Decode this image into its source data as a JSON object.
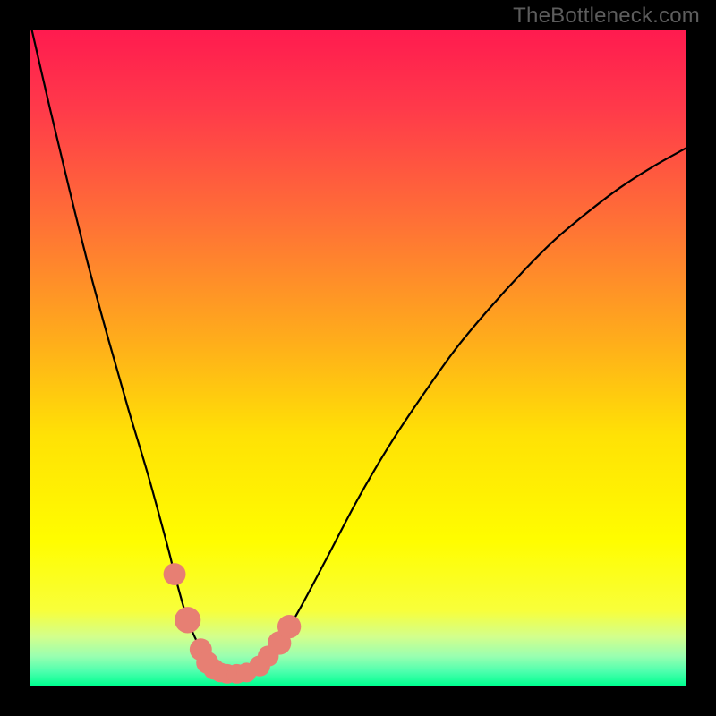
{
  "watermark": "TheBottleneck.com",
  "chart_data": {
    "type": "line",
    "title": "",
    "xlabel": "",
    "ylabel": "",
    "xlim": [
      0,
      100
    ],
    "ylim": [
      0,
      100
    ],
    "series": [
      {
        "name": "curve",
        "x": [
          0.0,
          3.0,
          6.0,
          9.0,
          12.0,
          15.0,
          18.0,
          21.0,
          22.0,
          24.0,
          26.0,
          27.0,
          28.0,
          29.0,
          30.0,
          31.5,
          33.0,
          35.0,
          38.0,
          41.0,
          45.0,
          50.0,
          55.0,
          60.0,
          65.0,
          70.0,
          75.0,
          80.0,
          85.0,
          90.0,
          95.0,
          100.0
        ],
        "values": [
          101.0,
          88.0,
          75.5,
          63.5,
          52.5,
          42.0,
          32.0,
          21.0,
          17.0,
          10.0,
          5.5,
          3.5,
          2.5,
          2.0,
          1.8,
          1.8,
          2.0,
          3.0,
          6.5,
          11.5,
          19.0,
          28.5,
          37.0,
          44.5,
          51.5,
          57.5,
          63.0,
          68.0,
          72.2,
          76.0,
          79.2,
          82.0
        ]
      }
    ],
    "markers": [
      {
        "x": 22.0,
        "y": 17.0,
        "r": 1.7
      },
      {
        "x": 24.0,
        "y": 10.0,
        "r": 2.0
      },
      {
        "x": 26.0,
        "y": 5.5,
        "r": 1.7
      },
      {
        "x": 27.0,
        "y": 3.5,
        "r": 1.7
      },
      {
        "x": 28.0,
        "y": 2.5,
        "r": 1.6
      },
      {
        "x": 29.0,
        "y": 2.0,
        "r": 1.5
      },
      {
        "x": 30.0,
        "y": 1.8,
        "r": 1.5
      },
      {
        "x": 31.5,
        "y": 1.8,
        "r": 1.5
      },
      {
        "x": 33.0,
        "y": 2.0,
        "r": 1.5
      },
      {
        "x": 35.0,
        "y": 3.0,
        "r": 1.6
      },
      {
        "x": 36.3,
        "y": 4.5,
        "r": 1.6
      },
      {
        "x": 38.0,
        "y": 6.5,
        "r": 1.8
      },
      {
        "x": 39.5,
        "y": 9.0,
        "r": 1.8
      }
    ],
    "marker_color": "#e77f73",
    "background_gradient": {
      "stops": [
        {
          "offset": 0.0,
          "color": "#ff1b4f"
        },
        {
          "offset": 0.12,
          "color": "#ff3a4a"
        },
        {
          "offset": 0.3,
          "color": "#ff7335"
        },
        {
          "offset": 0.48,
          "color": "#ffaf1a"
        },
        {
          "offset": 0.62,
          "color": "#ffe205"
        },
        {
          "offset": 0.78,
          "color": "#fffd00"
        },
        {
          "offset": 0.885,
          "color": "#f8ff3a"
        },
        {
          "offset": 0.925,
          "color": "#d3ff8c"
        },
        {
          "offset": 0.955,
          "color": "#9affb0"
        },
        {
          "offset": 0.978,
          "color": "#4fffae"
        },
        {
          "offset": 1.0,
          "color": "#00ff90"
        }
      ]
    }
  }
}
